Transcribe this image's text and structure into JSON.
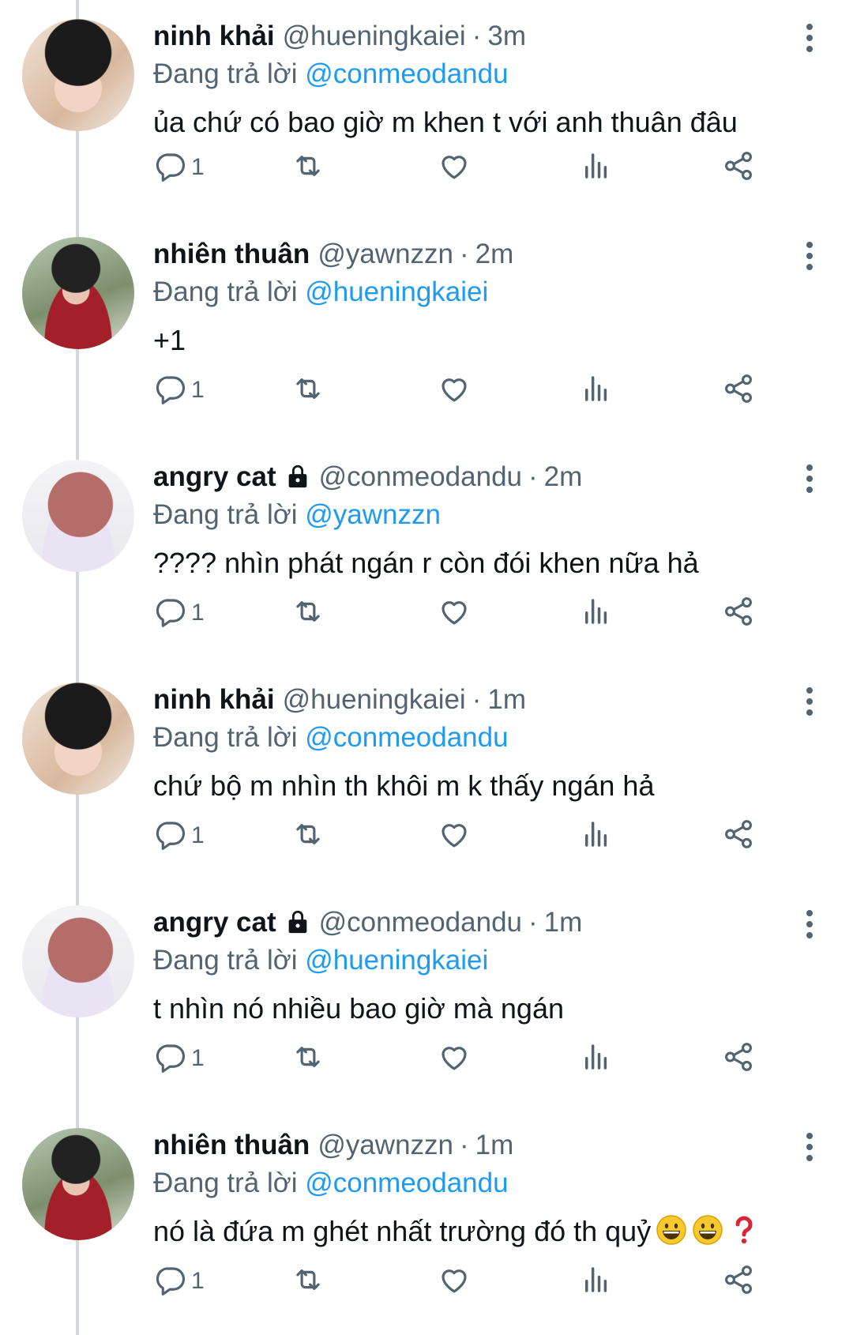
{
  "colors": {
    "accent": "#1d9bf0",
    "muted": "#536471",
    "text": "#0f1419",
    "thread": "#cfd9de"
  },
  "reply_prefix": "Đang trả lời",
  "tweets": [
    {
      "name": "ninh khải",
      "locked": false,
      "handle": "@hueningkaiei",
      "time": "3m",
      "reply_to": "@conmeodandu",
      "text": "ủa chứ có bao giờ m khen t với anh thuân đâu",
      "reply_count": "1",
      "avatar": "kai"
    },
    {
      "name": "nhiên thuân",
      "locked": false,
      "handle": "@yawnzzn",
      "time": "2m",
      "reply_to": "@hueningkaiei",
      "text": "+1",
      "reply_count": "1",
      "avatar": "yawn"
    },
    {
      "name": "angry cat",
      "locked": true,
      "handle": "@conmeodandu",
      "time": "2m",
      "reply_to": "@yawnzzn",
      "text": "???? nhìn phát ngán r còn đói khen nữa hả",
      "reply_count": "1",
      "avatar": "cat"
    },
    {
      "name": "ninh khải",
      "locked": false,
      "handle": "@hueningkaiei",
      "time": "1m",
      "reply_to": "@conmeodandu",
      "text": "chứ bộ m nhìn th khôi m k thấy ngán hả",
      "reply_count": "1",
      "avatar": "kai"
    },
    {
      "name": "angry cat",
      "locked": true,
      "handle": "@conmeodandu",
      "time": "1m",
      "reply_to": "@hueningkaiei",
      "text": "t nhìn nó nhiều bao giờ mà ngán",
      "reply_count": "1",
      "avatar": "cat"
    },
    {
      "name": "nhiên thuân",
      "locked": false,
      "handle": "@yawnzzn",
      "time": "1m",
      "reply_to": "@conmeodandu",
      "text": "nó là đứa m ghét nhất trường đó th quỷ",
      "reply_count": "1",
      "avatar": "yawn",
      "emojis": [
        "grinning-face-emoji",
        "grinning-face-emoji",
        "red-question-mark-emoji"
      ]
    }
  ]
}
